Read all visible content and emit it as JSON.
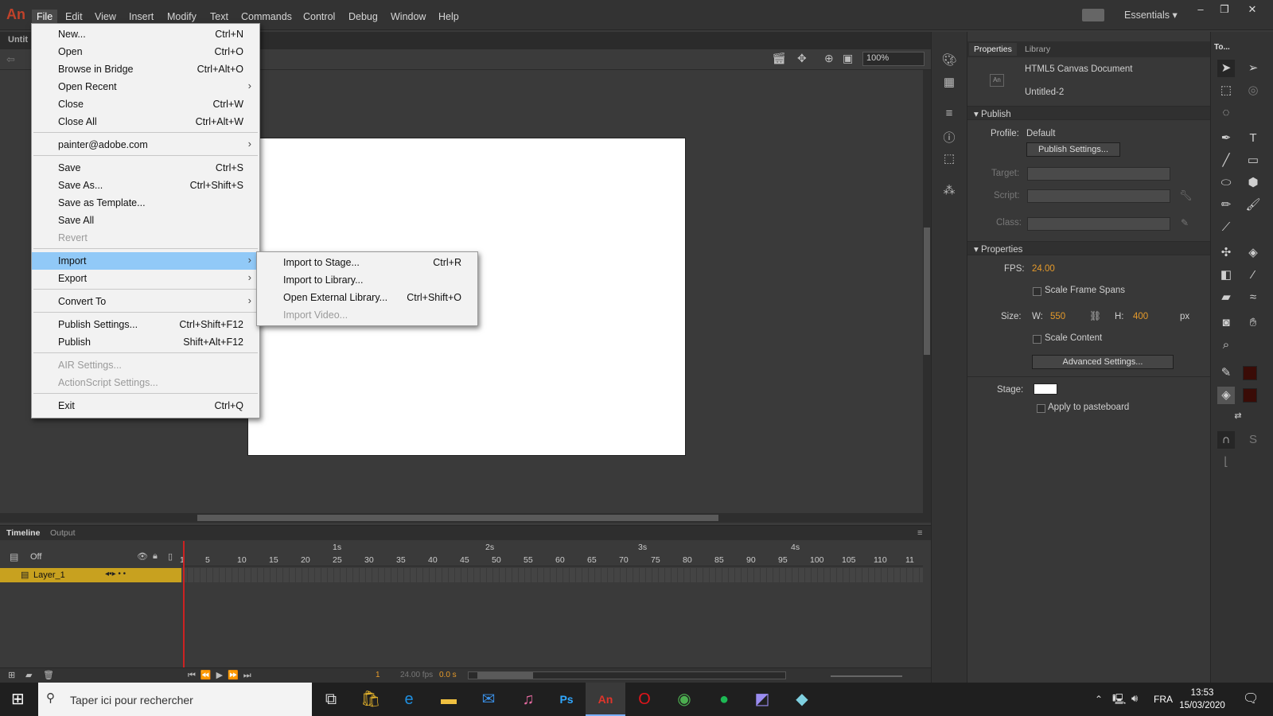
{
  "app": {
    "logo": "An",
    "doc_tab": "Untit"
  },
  "menubar": {
    "items": [
      "File",
      "Edit",
      "View",
      "Insert",
      "Modify",
      "Text",
      "Commands",
      "Control",
      "Debug",
      "Window",
      "Help"
    ],
    "workspace": "Essentials ▾",
    "win_minimize": "–",
    "win_restore": "❐",
    "win_close": "✕"
  },
  "file_menu": {
    "items": [
      {
        "label": "New...",
        "shortcut": "Ctrl+N"
      },
      {
        "label": "Open",
        "shortcut": "Ctrl+O"
      },
      {
        "label": "Browse in Bridge",
        "shortcut": "Ctrl+Alt+O"
      },
      {
        "label": "Open Recent",
        "shortcut": "›"
      },
      {
        "label": "Close",
        "shortcut": "Ctrl+W"
      },
      {
        "label": "Close All",
        "shortcut": "Ctrl+Alt+W"
      },
      {
        "label": "painter@adobe.com",
        "shortcut": "›"
      },
      {
        "label": "Save",
        "shortcut": "Ctrl+S"
      },
      {
        "label": "Save As...",
        "shortcut": "Ctrl+Shift+S"
      },
      {
        "label": "Save as Template...",
        "shortcut": ""
      },
      {
        "label": "Save All",
        "shortcut": ""
      },
      {
        "label": "Revert",
        "shortcut": ""
      },
      {
        "label": "Import",
        "shortcut": "›"
      },
      {
        "label": "Export",
        "shortcut": "›"
      },
      {
        "label": "Convert To",
        "shortcut": "›"
      },
      {
        "label": "Publish Settings...",
        "shortcut": "Ctrl+Shift+F12"
      },
      {
        "label": "Publish",
        "shortcut": "Shift+Alt+F12"
      },
      {
        "label": "AIR Settings...",
        "shortcut": ""
      },
      {
        "label": "ActionScript Settings...",
        "shortcut": ""
      },
      {
        "label": "Exit",
        "shortcut": "Ctrl+Q"
      }
    ]
  },
  "import_menu": {
    "items": [
      {
        "label": "Import to Stage...",
        "shortcut": "Ctrl+R"
      },
      {
        "label": "Import to Library...",
        "shortcut": ""
      },
      {
        "label": "Open External Library...",
        "shortcut": "Ctrl+Shift+O"
      },
      {
        "label": "Import Video...",
        "shortcut": ""
      }
    ]
  },
  "editbar": {
    "zoom": "100%"
  },
  "properties": {
    "tab_properties": "Properties",
    "tab_library": "Library",
    "doc_type": "HTML5 Canvas Document",
    "doc_name": "Untitled-2",
    "doc_icon": "An",
    "publish_header": "Publish",
    "profile_label": "Profile:",
    "profile_value": "Default",
    "publish_settings_btn": "Publish Settings...",
    "target_label": "Target:",
    "script_label": "Script:",
    "class_label": "Class:",
    "properties_header": "Properties",
    "fps_label": "FPS:",
    "fps_value": "24.00",
    "scale_frame_spans": "Scale Frame Spans",
    "size_label": "Size:",
    "w_label": "W:",
    "w_value": "550",
    "h_label": "H:",
    "h_value": "400",
    "unit": "px",
    "scale_content": "Scale Content",
    "advanced_btn": "Advanced Settings...",
    "stage_label": "Stage:",
    "stage_color": "#ffffff",
    "apply_pasteboard": "Apply to pasteboard"
  },
  "tools_panel": {
    "title": "To..."
  },
  "timeline": {
    "tab_timeline": "Timeline",
    "tab_output": "Output",
    "onion": "Off",
    "layer_name": "Layer_1",
    "sec_labels": [
      "1s",
      "2s",
      "3s",
      "4s"
    ],
    "frame_labels": [
      "1",
      "5",
      "10",
      "15",
      "20",
      "25",
      "30",
      "35",
      "40",
      "45",
      "50",
      "55",
      "60",
      "65",
      "70",
      "75",
      "80",
      "85",
      "90",
      "95",
      "100",
      "105",
      "110",
      "11"
    ],
    "current_frame": "1",
    "fps_display": "24.00 fps",
    "time_display": "0.0 s"
  },
  "taskbar": {
    "search_placeholder": "Taper ici pour rechercher",
    "lang": "FRA",
    "time": "13:53",
    "date": "15/03/2020"
  }
}
